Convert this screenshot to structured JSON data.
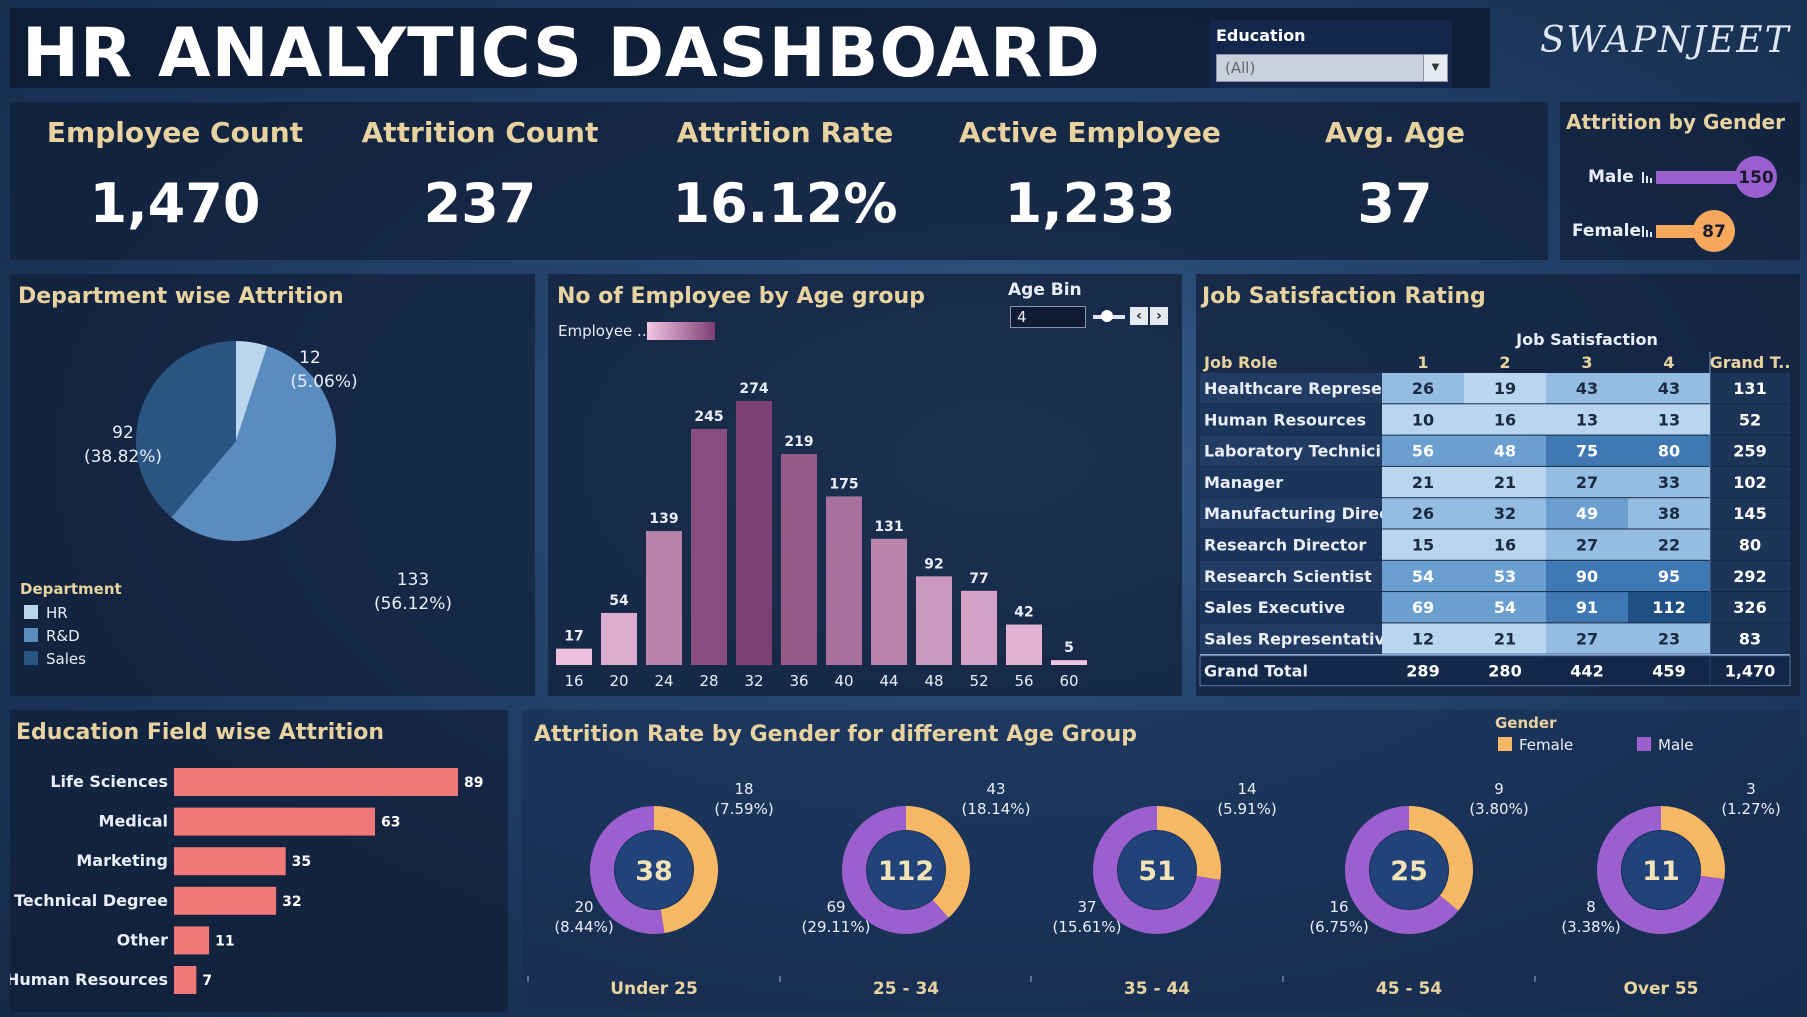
{
  "header": {
    "title": "HR ANALYTICS DASHBOARD",
    "brand": "SWAPNJEET",
    "education_filter": {
      "label": "Education",
      "value": "(All)"
    }
  },
  "kpis": [
    {
      "label": "Employee Count",
      "value": "1,470"
    },
    {
      "label": "Attrition Count",
      "value": "237"
    },
    {
      "label": "Attrition Rate",
      "value": "16.12%"
    },
    {
      "label": "Active Employee",
      "value": "1,233"
    },
    {
      "label": "Avg. Age",
      "value": "37"
    }
  ],
  "attrition_by_gender": {
    "title": "Attrition by Gender",
    "items": [
      {
        "label": "Male",
        "value": 150,
        "color": "#9b5fd0"
      },
      {
        "label": "Female",
        "value": 87,
        "color": "#f6a85c"
      }
    ]
  },
  "department_attrition": {
    "title": "Department wise Attrition",
    "legend_title": "Department",
    "slices": [
      {
        "name": "HR",
        "value": 12,
        "label": "12",
        "pct": "(5.06%)",
        "color": "#b9d6ec"
      },
      {
        "name": "R&D",
        "value": 133,
        "label": "133",
        "pct": "(56.12%)",
        "color": "#5b8cbf"
      },
      {
        "name": "Sales",
        "value": 92,
        "label": "92",
        "pct": "(38.82%)",
        "color": "#2a5583"
      }
    ]
  },
  "age_group": {
    "title": "No of Employee by Age group",
    "legend_label": "Employee ..",
    "age_bin_label": "Age Bin",
    "age_bin_value": "4"
  },
  "job_satisfaction": {
    "title": "Job Satisfaction Rating",
    "col_group": "Job Satisfaction",
    "headers": [
      "Job Role",
      "1",
      "2",
      "3",
      "4",
      "Grand T.."
    ],
    "rows": [
      {
        "role": "Healthcare Represe..",
        "vals": [
          26,
          19,
          43,
          43
        ],
        "total": 131
      },
      {
        "role": "Human Resources",
        "vals": [
          10,
          16,
          13,
          13
        ],
        "total": 52
      },
      {
        "role": "Laboratory Technici..",
        "vals": [
          56,
          48,
          75,
          80
        ],
        "total": 259
      },
      {
        "role": "Manager",
        "vals": [
          21,
          21,
          27,
          33
        ],
        "total": 102
      },
      {
        "role": "Manufacturing Direc..",
        "vals": [
          26,
          32,
          49,
          38
        ],
        "total": 145
      },
      {
        "role": "Research Director",
        "vals": [
          15,
          16,
          27,
          22
        ],
        "total": 80
      },
      {
        "role": "Research Scientist",
        "vals": [
          54,
          53,
          90,
          95
        ],
        "total": 292
      },
      {
        "role": "Sales Executive",
        "vals": [
          69,
          54,
          91,
          112
        ],
        "total": 326
      },
      {
        "role": "Sales Representative",
        "vals": [
          12,
          21,
          27,
          23
        ],
        "total": 83
      }
    ],
    "grand_total": {
      "label": "Grand Total",
      "vals": [
        289,
        280,
        442,
        459
      ],
      "total": "1,470"
    }
  },
  "education_field": {
    "title": "Education Field wise Attrition",
    "bar_color": "#f07878"
  },
  "gender_age": {
    "title": "Attrition Rate by Gender for different Age Group",
    "legend_title": "Gender",
    "legend": [
      {
        "label": "Female",
        "color": "#f6b865"
      },
      {
        "label": "Male",
        "color": "#9b5fd0"
      }
    ],
    "groups": [
      {
        "label": "Under 25",
        "total": "38",
        "female": 18,
        "female_pct": "(7.59%)",
        "male": 20,
        "male_pct": "(8.44%)"
      },
      {
        "label": "25 - 34",
        "total": "112",
        "female": 43,
        "female_pct": "(18.14%)",
        "male": 69,
        "male_pct": "(29.11%)"
      },
      {
        "label": "35 - 44",
        "total": "51",
        "female": 14,
        "female_pct": "(5.91%)",
        "male": 37,
        "male_pct": "(15.61%)"
      },
      {
        "label": "45 - 54",
        "total": "25",
        "female": 9,
        "female_pct": "(3.80%)",
        "male": 16,
        "male_pct": "(6.75%)"
      },
      {
        "label": "Over 55",
        "total": "11",
        "female": 3,
        "female_pct": "(1.27%)",
        "male": 8,
        "male_pct": "(3.38%)"
      }
    ]
  },
  "chart_data": [
    {
      "type": "pie",
      "title": "Department wise Attrition",
      "categories": [
        "HR",
        "R&D",
        "Sales"
      ],
      "values": [
        12,
        133,
        92
      ]
    },
    {
      "type": "bar",
      "title": "No of Employee by Age group",
      "categories": [
        "16",
        "20",
        "24",
        "28",
        "32",
        "36",
        "40",
        "44",
        "48",
        "52",
        "56",
        "60"
      ],
      "values": [
        17,
        54,
        139,
        245,
        274,
        219,
        175,
        131,
        92,
        77,
        42,
        5
      ]
    },
    {
      "type": "bar",
      "title": "Education Field wise Attrition",
      "categories": [
        "Life Sciences",
        "Medical",
        "Marketing",
        "Technical Degree",
        "Other",
        "Human Resources"
      ],
      "values": [
        89,
        63,
        35,
        32,
        11,
        7
      ]
    },
    {
      "type": "pie",
      "title": "Attrition Rate by Gender for different Age Group",
      "categories": [
        "Under 25",
        "25 - 34",
        "35 - 44",
        "45 - 54",
        "Over 55"
      ],
      "series": [
        {
          "name": "Female",
          "values": [
            18,
            43,
            14,
            9,
            3
          ]
        },
        {
          "name": "Male",
          "values": [
            20,
            69,
            37,
            16,
            8
          ]
        }
      ]
    }
  ]
}
